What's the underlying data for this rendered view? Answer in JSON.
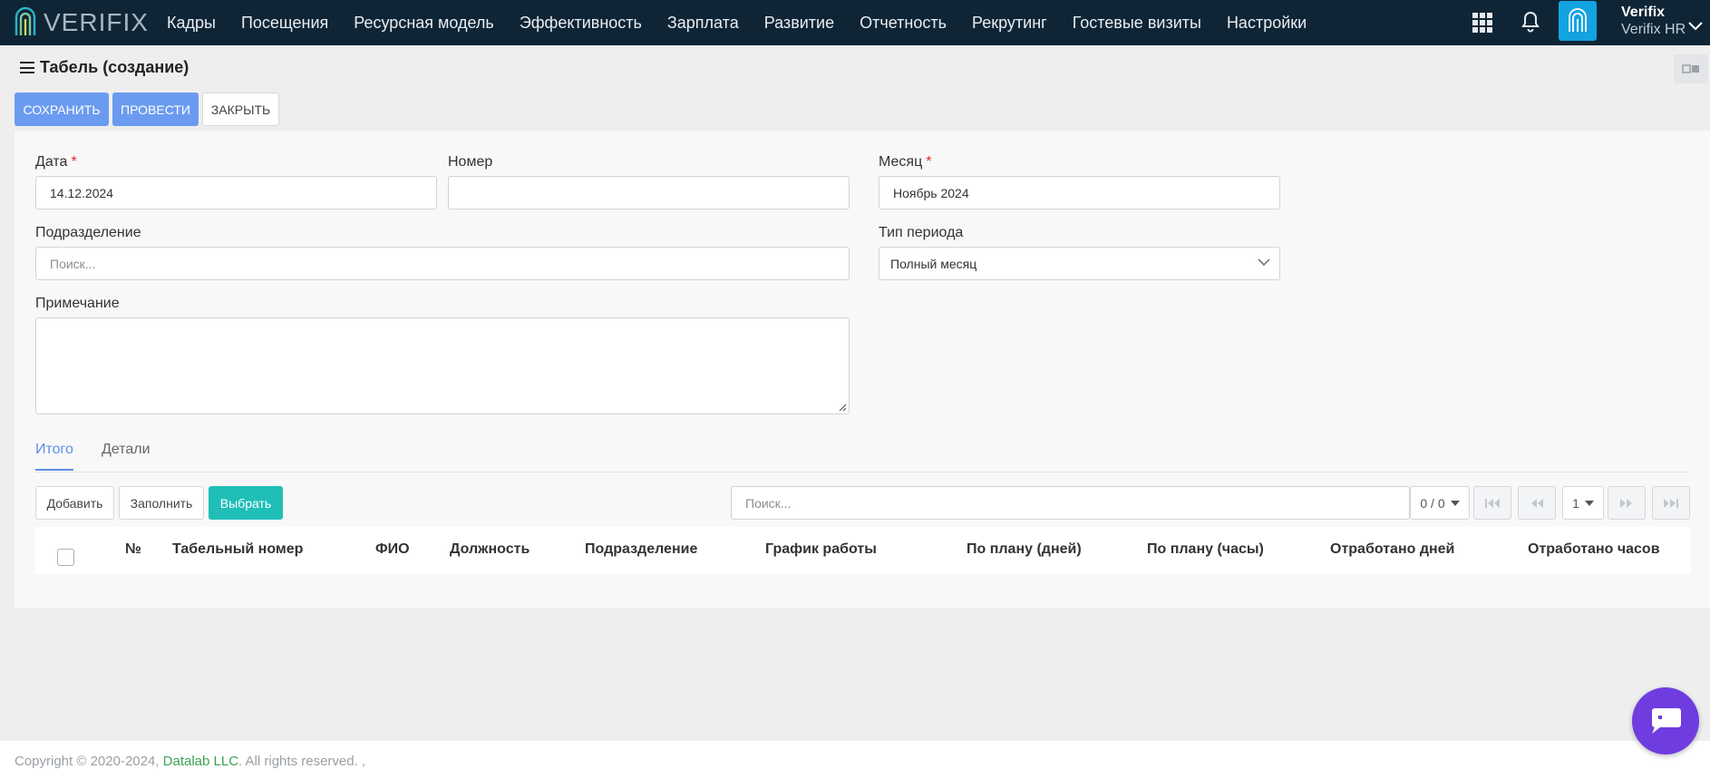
{
  "brand": {
    "logo_text": "VERIFIX"
  },
  "nav": {
    "items": [
      "Кадры",
      "Посещения",
      "Ресурсная модель",
      "Эффективность",
      "Зарплата",
      "Развитие",
      "Отчетность",
      "Рекрутинг",
      "Гостевые визиты",
      "Настройки"
    ]
  },
  "user": {
    "name": "Verifix",
    "org": "Verifix HR"
  },
  "page": {
    "title": "Табель (создание)"
  },
  "actions": {
    "save": "СОХРАНИТЬ",
    "post": "ПРОВЕСТИ",
    "close": "ЗАКРЫТЬ"
  },
  "form": {
    "date": {
      "label": "Дата",
      "required_mark": "*",
      "value": "14.12.2024"
    },
    "number": {
      "label": "Номер",
      "value": ""
    },
    "month": {
      "label": "Месяц",
      "required_mark": "*",
      "value": "Ноябрь 2024"
    },
    "division": {
      "label": "Подразделение",
      "placeholder": "Поиск..."
    },
    "period_type": {
      "label": "Тип периода",
      "value": "Полный месяц"
    },
    "note": {
      "label": "Примечание",
      "value": ""
    }
  },
  "tabs": [
    {
      "label": "Итого",
      "active": true
    },
    {
      "label": "Детали",
      "active": false
    }
  ],
  "table_toolbar": {
    "add": "Добавить",
    "fill": "Заполнить",
    "select": "Выбрать",
    "search_placeholder": "Поиск...",
    "count": "0 / 0",
    "page": "1"
  },
  "table": {
    "columns": [
      "№",
      "Табельный номер",
      "ФИО",
      "Должность",
      "Подразделение",
      "График работы",
      "По плану (дней)",
      "По плану (часы)",
      "Отработано дней",
      "Отработано часов"
    ],
    "rows": []
  },
  "footer": {
    "prefix": "Copyright © 2020-2024, ",
    "company": "Datalab LLC",
    "suffix": ". All rights reserved. ,"
  },
  "colors": {
    "navbar": "#0f2535",
    "primary": "#6b9bf0",
    "teal": "#1fbfb8",
    "chat": "#6f3ce0",
    "avatar": "#13a3e0"
  }
}
